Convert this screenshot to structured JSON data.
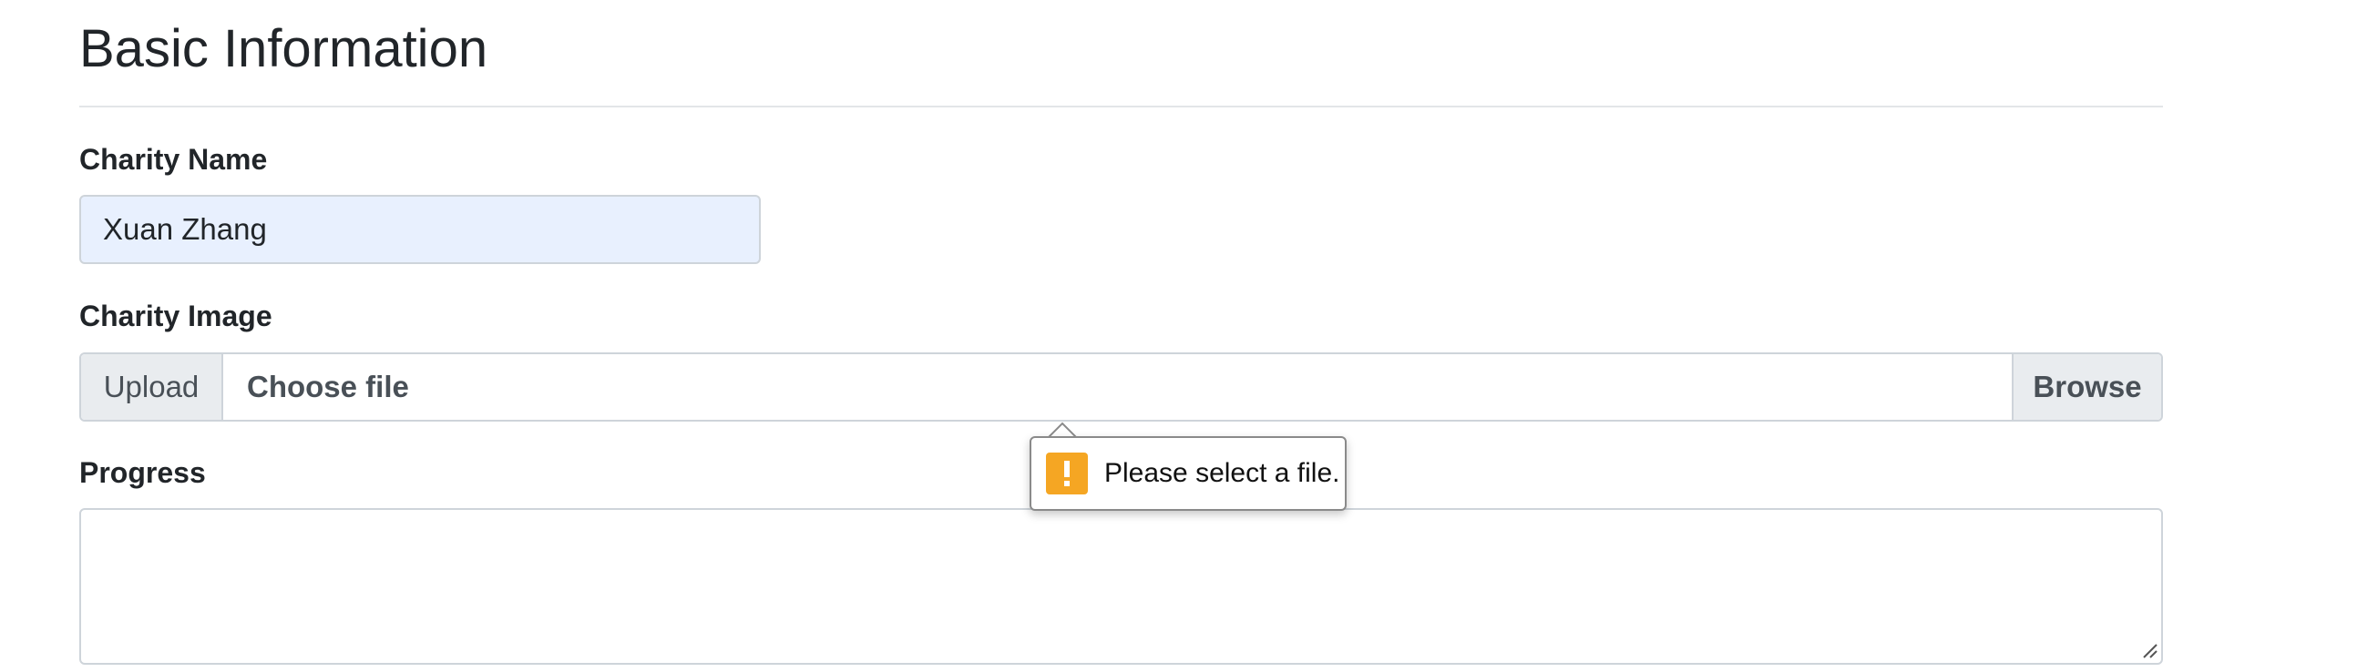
{
  "section": {
    "title": "Basic Information"
  },
  "charity_name": {
    "label": "Charity Name",
    "value": "Xuan Zhang"
  },
  "charity_image": {
    "label": "Charity Image",
    "prepend": "Upload",
    "file_placeholder": "Choose file",
    "browse_label": "Browse"
  },
  "progress": {
    "label": "Progress",
    "value": ""
  },
  "validation_tooltip": {
    "message": "Please select a file.",
    "icon": "warning-icon",
    "icon_color": "#f5a623"
  },
  "colors": {
    "input_autofill_bg": "#e8f0fe",
    "input_group_bg": "#e9ecef",
    "border": "#ced4da"
  }
}
